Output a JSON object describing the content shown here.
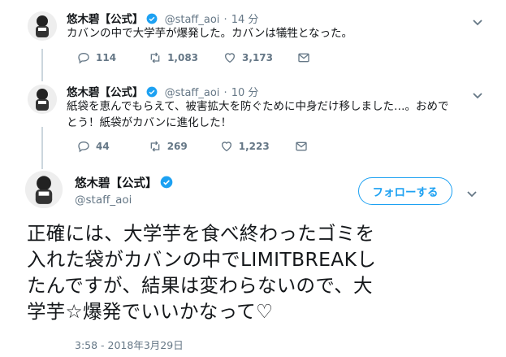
{
  "tweets": [
    {
      "name": "悠木碧【公式】",
      "handle": "@staff_aoi",
      "sep": "·",
      "time": "14 分",
      "text": "カバンの中で大学芋が爆発した。カバンは犠牲となった。",
      "replies": "114",
      "retweets": "1,083",
      "likes": "3,173"
    },
    {
      "name": "悠木碧【公式】",
      "handle": "@staff_aoi",
      "sep": "·",
      "time": "10 分",
      "text_line1": "紙袋を恵んでもらえて、被害拡大を防ぐために中身だけ移しました…。おめで",
      "text_line2": "とう！紙袋がカバンに進化した！",
      "replies": "44",
      "retweets": "269",
      "likes": "1,223"
    }
  ],
  "main": {
    "name": "悠木碧【公式】",
    "handle": "@staff_aoi",
    "follow_label": "フォローする",
    "text_lines": [
      "正確には、大学芋を食べ終わったゴミを",
      "入れた袋がカバンの中でLIMITBREAKし",
      "たんですが、結果は変わらないので、大",
      "学芋☆爆発でいいかなって♡"
    ],
    "timestamp": "3:58 - 2018年3月29日"
  },
  "colors": {
    "accent": "#1da1f2",
    "muted": "#657786",
    "line": "#ccd6dd"
  }
}
